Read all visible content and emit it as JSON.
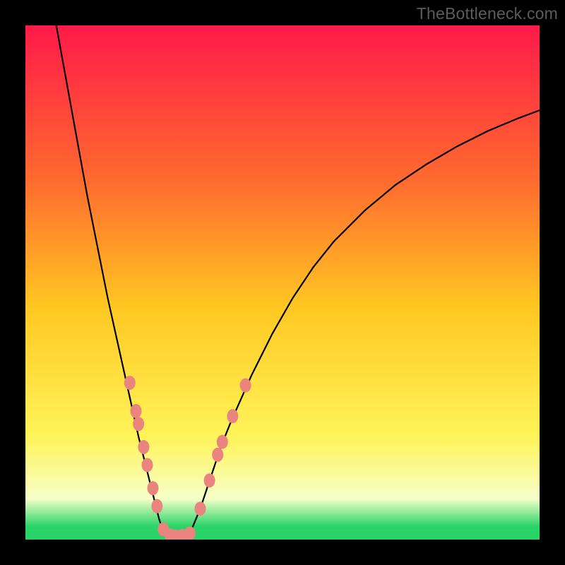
{
  "watermark": "TheBottleneck.com",
  "colors": {
    "frame": "#000000",
    "gradient_top": "#ff1a49",
    "gradient_mid_upper": "#ff6a2f",
    "gradient_mid": "#ffc822",
    "gradient_mid_lower": "#fff459",
    "gradient_pale": "#f7ffc8",
    "gradient_green": "#28d468",
    "curve": "#000000",
    "marker_fill": "#e9847e",
    "marker_stroke": "#d46a62"
  },
  "chart_data": {
    "type": "line",
    "title": "",
    "xlabel": "",
    "ylabel": "",
    "xlim": [
      0,
      100
    ],
    "ylim": [
      0,
      100
    ],
    "series": [
      {
        "name": "left-branch",
        "x": [
          6,
          8,
          10,
          12,
          14,
          16,
          18,
          20,
          22,
          23,
          24,
          25,
          26,
          27
        ],
        "y": [
          100,
          89,
          78,
          67,
          57,
          47,
          38,
          29,
          20,
          16,
          12,
          8,
          4,
          1
        ]
      },
      {
        "name": "valley-floor",
        "x": [
          27,
          28,
          29,
          30,
          31,
          32
        ],
        "y": [
          1,
          0.6,
          0.5,
          0.5,
          0.7,
          1.2
        ]
      },
      {
        "name": "right-branch",
        "x": [
          32,
          34,
          36,
          38,
          40,
          44,
          48,
          52,
          56,
          60,
          66,
          72,
          78,
          84,
          90,
          96,
          100
        ],
        "y": [
          1.2,
          6,
          12,
          18,
          23,
          32,
          40,
          47,
          53,
          58,
          64,
          69,
          73,
          76.5,
          79.5,
          82,
          83.5
        ]
      }
    ],
    "markers": {
      "name": "sample-points",
      "points": [
        {
          "x": 20.3,
          "y": 30.5
        },
        {
          "x": 21.5,
          "y": 25.0
        },
        {
          "x": 22.0,
          "y": 22.5
        },
        {
          "x": 23.0,
          "y": 18.0
        },
        {
          "x": 23.7,
          "y": 14.5
        },
        {
          "x": 24.8,
          "y": 10.0
        },
        {
          "x": 25.6,
          "y": 6.5
        },
        {
          "x": 26.8,
          "y": 2.0
        },
        {
          "x": 28.2,
          "y": 0.8
        },
        {
          "x": 29.2,
          "y": 0.6
        },
        {
          "x": 30.5,
          "y": 0.7
        },
        {
          "x": 32.0,
          "y": 1.2
        },
        {
          "x": 34.0,
          "y": 6.0
        },
        {
          "x": 35.8,
          "y": 11.5
        },
        {
          "x": 37.4,
          "y": 16.5
        },
        {
          "x": 38.3,
          "y": 19.0
        },
        {
          "x": 40.3,
          "y": 24.0
        },
        {
          "x": 42.8,
          "y": 30.0
        }
      ]
    }
  }
}
